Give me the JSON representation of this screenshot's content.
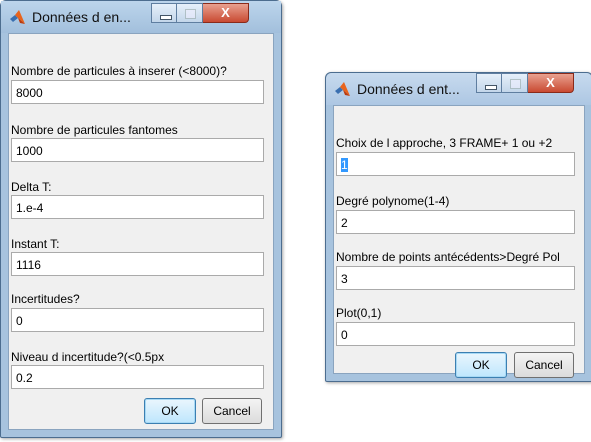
{
  "dialog1": {
    "title": "Données d en...",
    "close_glyph": "X",
    "fields": [
      {
        "label": "Nombre de particules à inserer (<8000)?",
        "value": "8000"
      },
      {
        "label": "Nombre de particules fantomes",
        "value": "1000"
      },
      {
        "label": "Delta T:",
        "value": "1.e-4"
      },
      {
        "label": "Instant T:",
        "value": "1116"
      },
      {
        "label": "Incertitudes?",
        "value": "0"
      },
      {
        "label": "Niveau d incertitude?(<0.5px",
        "value": "0.2"
      }
    ],
    "ok_label": "OK",
    "cancel_label": "Cancel"
  },
  "dialog2": {
    "title": "Données d ent...",
    "close_glyph": "X",
    "fields": [
      {
        "label": "Choix de l approche, 3 FRAME+ 1 ou +2",
        "value": "1"
      },
      {
        "label": "Degré polynome(1-4)",
        "value": "2"
      },
      {
        "label": "Nombre de points antécédents>Degré Pol",
        "value": "3"
      },
      {
        "label": "Plot(0,1)",
        "value": "0"
      }
    ],
    "ok_label": "OK",
    "cancel_label": "Cancel"
  },
  "colors": {
    "frame": "#a7c3de",
    "close_button": "#c94a32",
    "selection": "#3399ff"
  }
}
